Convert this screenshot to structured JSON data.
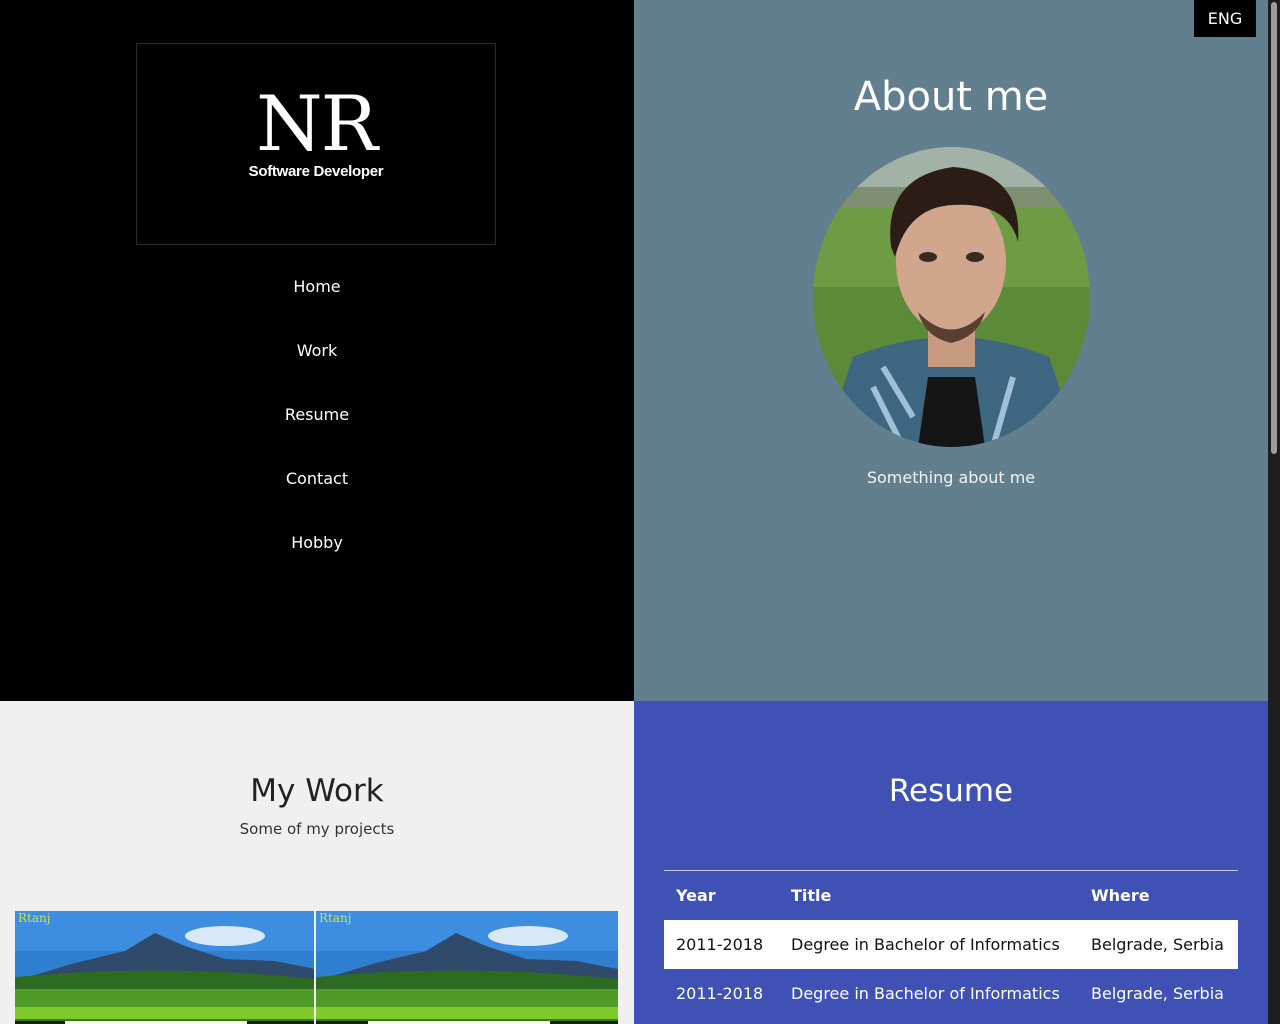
{
  "logo": {
    "mark": "NR",
    "subtitle": "Software Developer"
  },
  "nav": [
    "Home",
    "Work",
    "Resume",
    "Contact",
    "Hobby"
  ],
  "language": "ENG",
  "about": {
    "title": "About me",
    "text": "Something about me"
  },
  "work": {
    "title": "My Work",
    "subtitle": "Some of my projects",
    "projects": [
      {
        "caption": "Rtanj"
      },
      {
        "caption": "Rtanj"
      }
    ]
  },
  "resume": {
    "title": "Resume",
    "headers": [
      "Year",
      "Title",
      "Where"
    ],
    "rows": [
      [
        "2011-2018",
        "Degree in Bachelor of Informatics",
        "Belgrade, Serbia"
      ],
      [
        "2011-2018",
        "Degree in Bachelor of Informatics",
        "Belgrade, Serbia"
      ]
    ]
  }
}
